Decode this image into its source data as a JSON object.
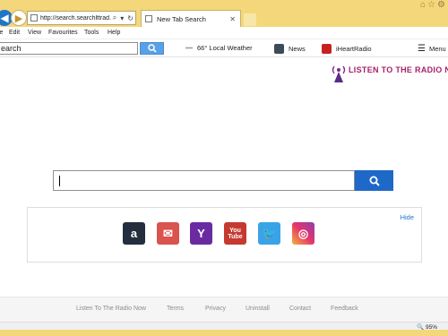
{
  "browser": {
    "address": "http://search.searchlttrad...",
    "tab_title": "New Tab Search"
  },
  "menu": [
    "le",
    "Edit",
    "View",
    "Favourites",
    "Tools",
    "Help"
  ],
  "toolbar": {
    "search_value": "earch",
    "weather": "66° Local Weather",
    "news": "News",
    "iheart": "iHeartRadio",
    "menu": "Menu"
  },
  "logo": {
    "text": "LISTEN TO THE RADIO NOW"
  },
  "search": {
    "value": ""
  },
  "shortcuts": {
    "hide_label": "Hide",
    "items": [
      {
        "name": "amazon",
        "glyph": "a"
      },
      {
        "name": "gmail",
        "glyph": "✉"
      },
      {
        "name": "yahoo",
        "glyph": "Y"
      },
      {
        "name": "youtube",
        "glyph": "You Tube"
      },
      {
        "name": "twitter",
        "glyph": "🐦"
      },
      {
        "name": "instagram",
        "glyph": "◎"
      }
    ]
  },
  "footer": [
    "Listen To The Radio Now",
    "Terms",
    "Privacy",
    "Uninstall",
    "Contact",
    "Feedback"
  ],
  "status": {
    "zoom": "95%"
  }
}
